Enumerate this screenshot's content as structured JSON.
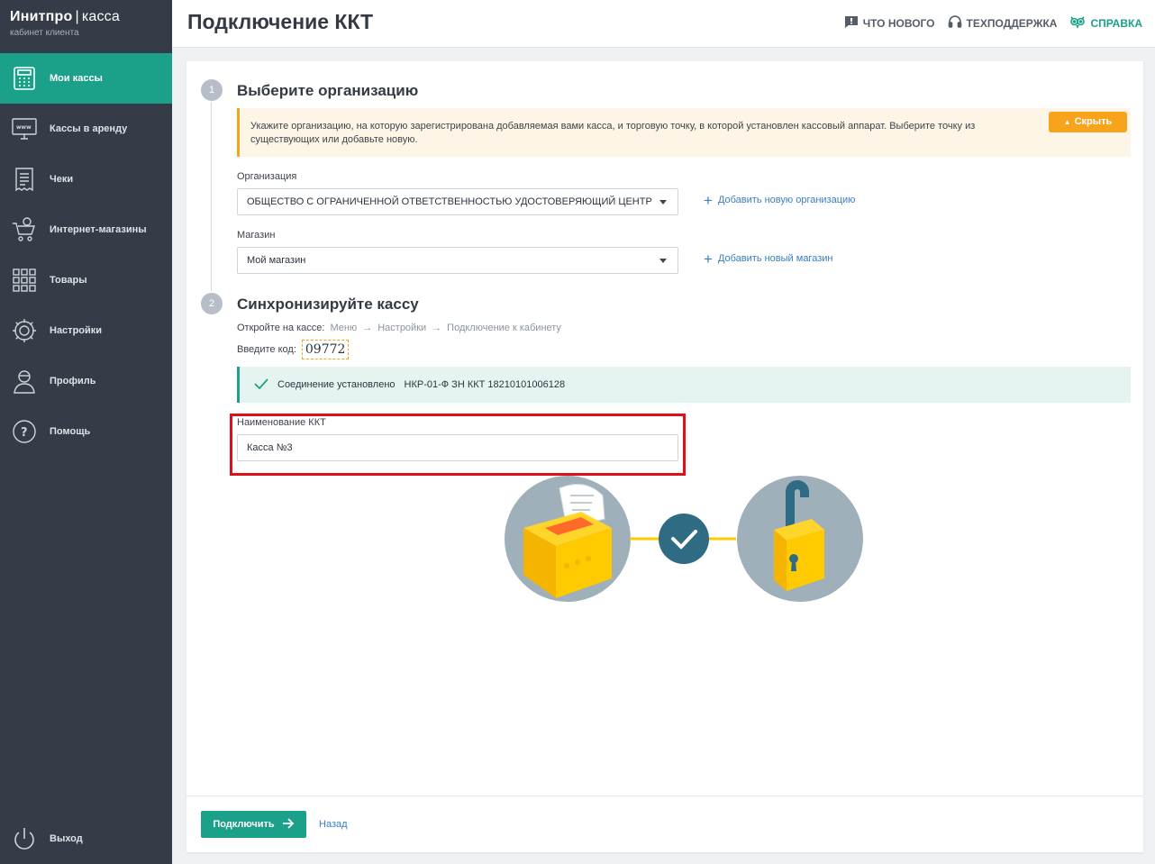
{
  "brand": {
    "name": "Инитпро",
    "separator": "|",
    "product": "касса",
    "subtitle": "кабинет клиента"
  },
  "sidebar": {
    "items": [
      {
        "label": "Мои кассы",
        "icon": "cash-register-icon",
        "active": true
      },
      {
        "label": "Кассы в аренду",
        "icon": "www-monitor-icon"
      },
      {
        "label": "Чеки",
        "icon": "receipt-icon"
      },
      {
        "label": "Интернет-магазины",
        "icon": "online-cart-icon"
      },
      {
        "label": "Товары",
        "icon": "grid-icon"
      },
      {
        "label": "Настройки",
        "icon": "gear-icon"
      },
      {
        "label": "Профиль",
        "icon": "user-icon"
      },
      {
        "label": "Помощь",
        "icon": "question-icon"
      }
    ],
    "logout": {
      "label": "Выход",
      "icon": "power-icon"
    }
  },
  "header": {
    "title": "Подключение ККТ",
    "links": [
      {
        "label": "ЧТО НОВОГО",
        "icon": "news-icon"
      },
      {
        "label": "ТЕХПОДДЕРЖКА",
        "icon": "headset-icon"
      },
      {
        "label": "СПРАВКА",
        "icon": "owl-icon"
      }
    ]
  },
  "step1": {
    "number": "1",
    "title": "Выберите организацию",
    "notice": "Укажите организацию, на которую зарегистрирована добавляемая вами касса, и торговую точку, в которой установлен кассовый аппарат. Выберите точку из существующих или добавьте новую.",
    "hide_label": "Скрыть",
    "org_label": "Организация",
    "org_value": "ОБЩЕСТВО С ОГРАНИЧЕННОЙ ОТВЕТСТВЕННОСТЬЮ УДОСТОВЕРЯЮЩИЙ ЦЕНТР",
    "add_org": "Добавить новую организацию",
    "store_label": "Магазин",
    "store_value": "Мой магазин",
    "add_store": "Добавить новый магазин"
  },
  "step2": {
    "number": "2",
    "title": "Синхронизируйте кассу",
    "path_prefix": "Откройте на кассе:",
    "path": [
      "Меню",
      "Настройки",
      "Подключение к кабинету"
    ],
    "path_arrow": "→",
    "code_label": "Введите код:",
    "code": "09772",
    "success_text": "Соединение установлено",
    "device": "НКР-01-Ф ЗН ККТ 18210101006128",
    "kkt_label": "Наименование ККТ",
    "kkt_value": "Касса №3"
  },
  "footer": {
    "connect": "Подключить",
    "back": "Назад"
  },
  "colors": {
    "accent": "#1ba08a",
    "sidebar": "#353c47",
    "warning": "#f7a31c",
    "link": "#3a7dc0",
    "highlight": "#e0101a"
  }
}
